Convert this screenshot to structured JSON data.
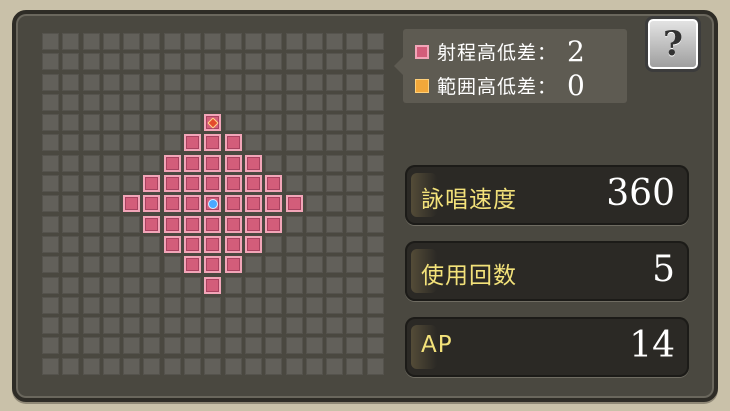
{
  "legend": {
    "range_height_label": "射程高低差：",
    "range_height_value": "2",
    "area_height_label": "範囲高低差：",
    "area_height_value": "0",
    "range_color": "#d35d7a",
    "area_color": "#f3a83a"
  },
  "help_button": {
    "label": "?"
  },
  "stats": {
    "cast_speed_label": "詠唱速度",
    "cast_speed_value": "360",
    "uses_label": "使用回数",
    "uses_value": "5",
    "ap_label": "AP",
    "ap_value": "14"
  },
  "grid": {
    "cols": 17,
    "rows": 17,
    "range_rows": [
      {
        "row": 4,
        "from": 8,
        "to": 8
      },
      {
        "row": 5,
        "from": 7,
        "to": 9
      },
      {
        "row": 6,
        "from": 6,
        "to": 10
      },
      {
        "row": 7,
        "from": 5,
        "to": 11
      },
      {
        "row": 8,
        "from": 4,
        "to": 12
      },
      {
        "row": 9,
        "from": 5,
        "to": 11
      },
      {
        "row": 10,
        "from": 6,
        "to": 10
      },
      {
        "row": 11,
        "from": 7,
        "to": 9
      },
      {
        "row": 12,
        "from": 8,
        "to": 8
      }
    ],
    "target_cell": {
      "row": 4,
      "col": 8
    },
    "origin_cell": {
      "row": 8,
      "col": 8
    }
  }
}
